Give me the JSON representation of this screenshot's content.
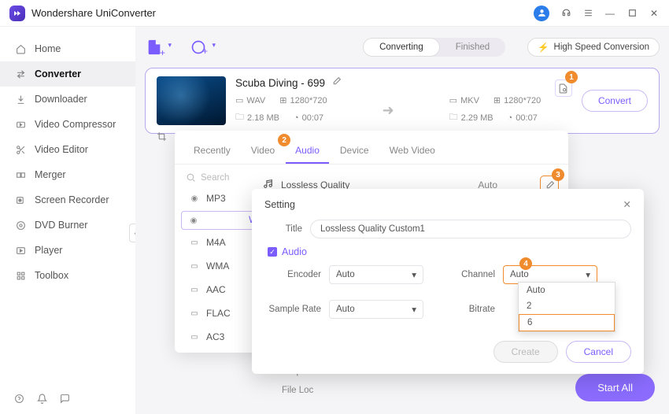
{
  "app_title": "Wondershare UniConverter",
  "sidebar": {
    "items": [
      {
        "label": "Home",
        "icon": "home"
      },
      {
        "label": "Converter",
        "icon": "converter"
      },
      {
        "label": "Downloader",
        "icon": "download"
      },
      {
        "label": "Video Compressor",
        "icon": "compress"
      },
      {
        "label": "Video Editor",
        "icon": "scissors"
      },
      {
        "label": "Merger",
        "icon": "merge"
      },
      {
        "label": "Screen Recorder",
        "icon": "record"
      },
      {
        "label": "DVD Burner",
        "icon": "disc"
      },
      {
        "label": "Player",
        "icon": "play"
      },
      {
        "label": "Toolbox",
        "icon": "grid"
      }
    ]
  },
  "segments": {
    "converting": "Converting",
    "finished": "Finished"
  },
  "high_speed": "High Speed Conversion",
  "file": {
    "name": "Scuba Diving - 699",
    "src": {
      "format": "WAV",
      "res": "1280*720",
      "size": "2.18 MB",
      "dur": "00:07"
    },
    "dst": {
      "format": "MKV",
      "res": "1280*720",
      "size": "2.29 MB",
      "dur": "00:07"
    },
    "convert": "Convert"
  },
  "format_tabs": [
    "Recently",
    "Video",
    "Audio",
    "Device",
    "Web Video"
  ],
  "search_placeholder": "Search",
  "format_list": [
    "MP3",
    "WAV",
    "M4A",
    "WMA",
    "AAC",
    "FLAC",
    "AC3"
  ],
  "quality": {
    "label": "Lossless Quality",
    "auto": "Auto"
  },
  "settings": {
    "title": "Setting",
    "title_label": "Title",
    "title_value": "Lossless Quality Custom1",
    "section": "Audio",
    "encoder": {
      "label": "Encoder",
      "value": "Auto"
    },
    "sample_rate": {
      "label": "Sample Rate",
      "value": "Auto"
    },
    "channel": {
      "label": "Channel",
      "value": "Auto",
      "options": [
        "Auto",
        "2",
        "6"
      ]
    },
    "bitrate": {
      "label": "Bitrate"
    },
    "create": "Create",
    "cancel": "Cancel"
  },
  "badges": {
    "b1": "1",
    "b2": "2",
    "b3": "3",
    "b4": "4"
  },
  "footer": {
    "output": "Output",
    "file_loc": "File Loc"
  },
  "start_all": "Start All"
}
